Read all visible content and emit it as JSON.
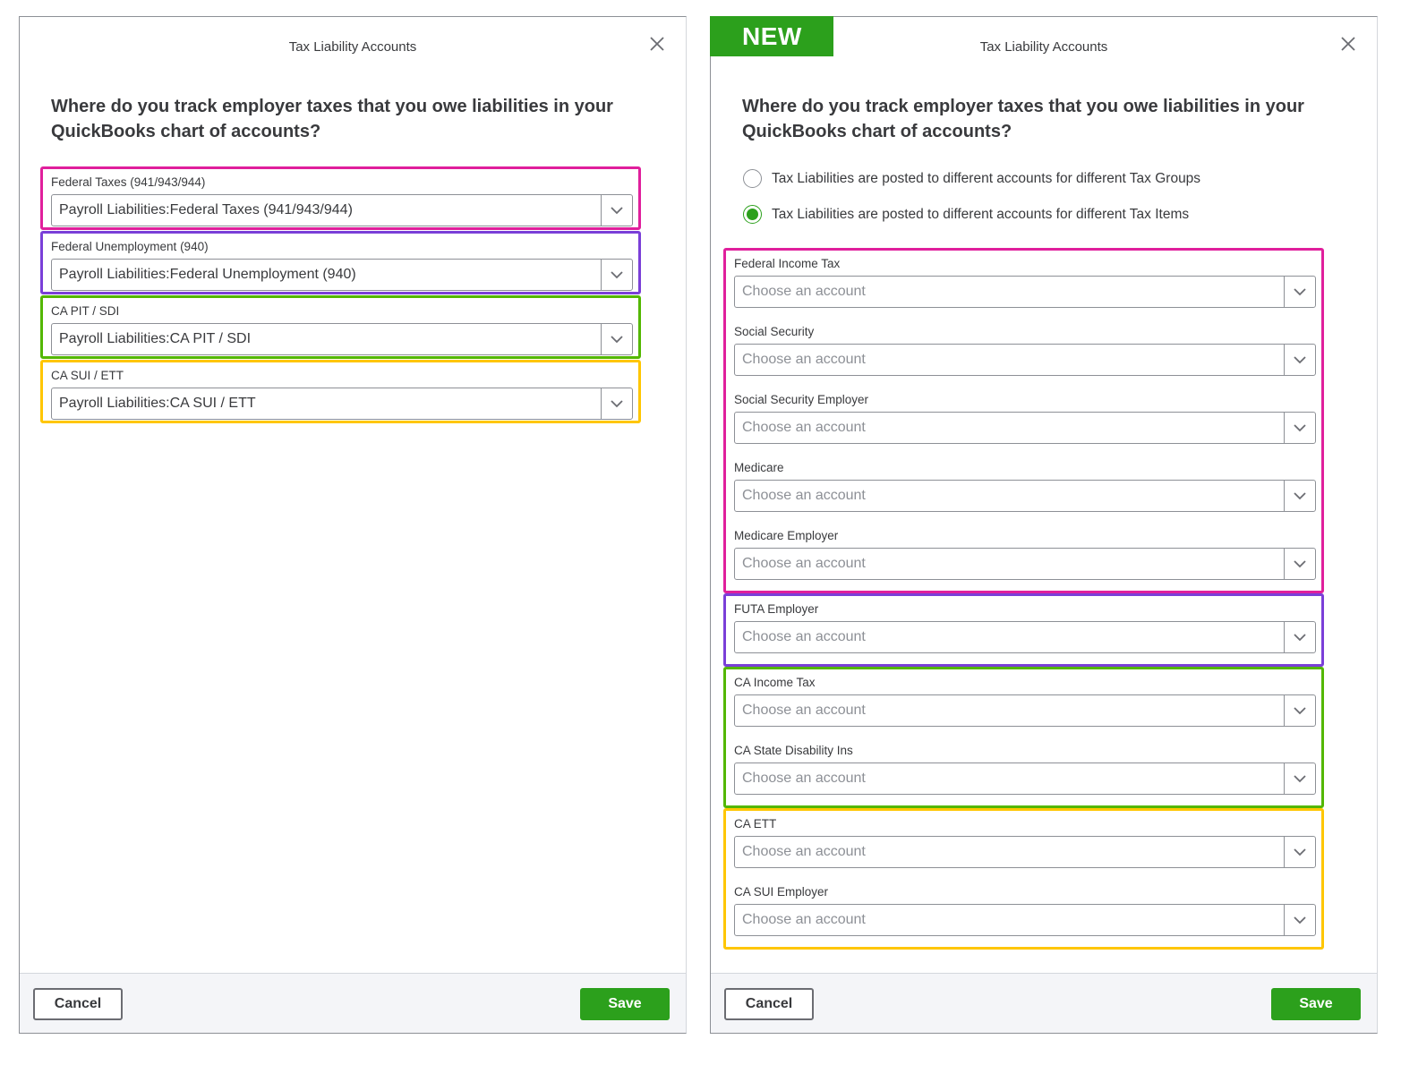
{
  "colors": {
    "federal": "#e01f9c",
    "unemployment": "#7a3fd8",
    "state": "#53b700",
    "sui": "#ffc600",
    "brand_green": "#2ca01c"
  },
  "old_dialog": {
    "title": "Tax Liability Accounts",
    "close_icon": "close-icon",
    "question": "Where do you track employer taxes that you owe liabilities in your QuickBooks chart of accounts?",
    "groups": [
      {
        "color_key": "federal",
        "fields": [
          {
            "label": "Federal Taxes (941/943/944)",
            "value": "Payroll Liabilities:Federal Taxes (941/943/944)"
          }
        ]
      },
      {
        "color_key": "unemployment",
        "fields": [
          {
            "label": "Federal Unemployment (940)",
            "value": "Payroll Liabilities:Federal Unemployment (940)"
          }
        ]
      },
      {
        "color_key": "state",
        "fields": [
          {
            "label": "CA PIT / SDI",
            "value": "Payroll Liabilities:CA PIT / SDI"
          }
        ]
      },
      {
        "color_key": "sui",
        "fields": [
          {
            "label": "CA SUI / ETT",
            "value": "Payroll Liabilities:CA SUI / ETT"
          }
        ]
      }
    ],
    "cancel_label": "Cancel",
    "save_label": "Save"
  },
  "new_dialog": {
    "badge": "NEW",
    "title": "Tax Liability Accounts",
    "close_icon": "close-icon",
    "question": "Where do you track employer taxes that you owe liabilities in your QuickBooks chart of accounts?",
    "radio_options": [
      {
        "label": "Tax Liabilities are posted to different accounts for different Tax Groups",
        "checked": false
      },
      {
        "label": "Tax Liabilities are posted to different accounts for different Tax Items",
        "checked": true
      }
    ],
    "placeholder": "Choose an account",
    "groups": [
      {
        "color_key": "federal",
        "fields": [
          {
            "label": "Federal Income Tax",
            "value": ""
          },
          {
            "label": "Social Security",
            "value": ""
          },
          {
            "label": "Social Security Employer",
            "value": ""
          },
          {
            "label": "Medicare",
            "value": ""
          },
          {
            "label": "Medicare Employer",
            "value": ""
          }
        ]
      },
      {
        "color_key": "unemployment",
        "fields": [
          {
            "label": "FUTA Employer",
            "value": ""
          }
        ]
      },
      {
        "color_key": "state",
        "fields": [
          {
            "label": "CA Income Tax",
            "value": ""
          },
          {
            "label": "CA State Disability Ins",
            "value": ""
          }
        ]
      },
      {
        "color_key": "sui",
        "fields": [
          {
            "label": "CA ETT",
            "value": ""
          },
          {
            "label": "CA SUI Employer",
            "value": ""
          }
        ]
      }
    ],
    "cancel_label": "Cancel",
    "save_label": "Save"
  }
}
